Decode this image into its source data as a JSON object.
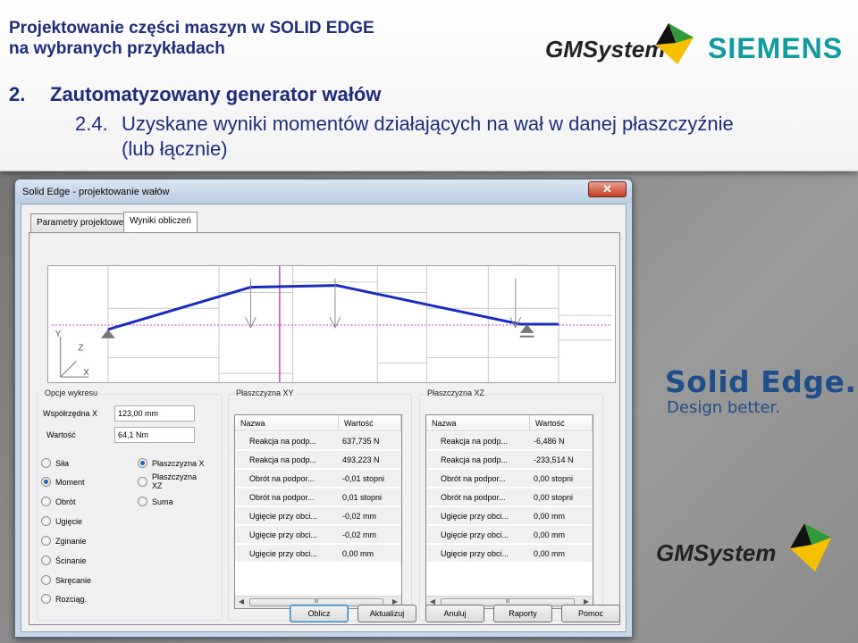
{
  "slide": {
    "title": "Projektowanie części maszyn w SOLID EDGE na wybranych przykładach",
    "title_line1": "Projektowanie części maszyn w SOLID EDGE",
    "title_line2": "na wybranych przykładach",
    "section_num": "2.",
    "section_title": "Zautomatyzowany generator wałów",
    "sub_num": "2.4.",
    "sub_title_line1": "Uzyskane wyniki momentów działających na wał w danej płaszczyźnie",
    "sub_title_line2": "(lub łącznie)",
    "gm_logo_text": "GMSystem",
    "siemens_logo_text": "SIEMENS",
    "solid_edge_logo": "Solid Edge.",
    "solid_edge_tagline": "Design better.",
    "gm_logo2_text": "GMSystem"
  },
  "window": {
    "title": "Solid Edge - projektowanie wałów",
    "close_label": "✕",
    "tabs": [
      {
        "label": "Parametry projektowe",
        "active": false
      },
      {
        "label": "Wyniki obliczeń",
        "active": true
      }
    ],
    "diagram": {
      "axis_y": "Y",
      "axis_z": "Z",
      "axis_x": "X",
      "line_color": "#1a2bbf",
      "marker_color": "#c040c0"
    },
    "options": {
      "group_title": "Opcje wykresu",
      "coord_label": "Współrzędna X",
      "coord_value": "123,00 mm",
      "value_label": "Wartość",
      "value_value": "64,1 Nm",
      "quantity_radios": [
        {
          "label": "Siła",
          "checked": false
        },
        {
          "label": "Moment",
          "checked": true
        },
        {
          "label": "Obrót",
          "checked": false
        },
        {
          "label": "Ugięcie",
          "checked": false
        },
        {
          "label": "Zginanie",
          "checked": false
        },
        {
          "label": "Ścinanie",
          "checked": false
        },
        {
          "label": "Skręcanie",
          "checked": false
        },
        {
          "label": "Rozciąg.",
          "checked": false
        }
      ],
      "plane_radios": [
        {
          "label": "Płaszczyzna X",
          "checked": true
        },
        {
          "label": "Płaszczyzna XZ",
          "checked": false
        },
        {
          "label": "Suma",
          "checked": false
        }
      ]
    },
    "plane_xy": {
      "group_title": "Płaszczyzna XY",
      "col_name": "Nazwa",
      "col_value": "Wartość",
      "rows": [
        {
          "name": "Reakcja na podp...",
          "value": "637,735 N"
        },
        {
          "name": "Reakcja na podp...",
          "value": "493,223 N"
        },
        {
          "name": "Obrót na podpor...",
          "value": "-0,01 stopni"
        },
        {
          "name": "Obrót na podpor...",
          "value": "0,01 stopni"
        },
        {
          "name": "Ugięcie przy obci...",
          "value": "-0,02 mm"
        },
        {
          "name": "Ugięcie przy obci...",
          "value": "-0,02 mm"
        },
        {
          "name": "Ugięcie przy obci...",
          "value": "0,00 mm"
        }
      ]
    },
    "plane_xz": {
      "group_title": "Płaszczyzna XZ",
      "col_name": "Nazwa",
      "col_value": "Wartość",
      "rows": [
        {
          "name": "Reakcja na podp...",
          "value": "-6,486 N"
        },
        {
          "name": "Reakcja na podp...",
          "value": "-233,514 N"
        },
        {
          "name": "Obrót na podpor...",
          "value": "0,00 stopni"
        },
        {
          "name": "Obrót na podpor...",
          "value": "0,00 stopni"
        },
        {
          "name": "Ugięcie przy obci...",
          "value": "0,00 mm"
        },
        {
          "name": "Ugięcie przy obci...",
          "value": "0,00 mm"
        },
        {
          "name": "Ugięcie przy obci...",
          "value": "0,00 mm"
        }
      ]
    },
    "scroll_thumb": "III",
    "buttons": {
      "oblicz": "Oblicz",
      "aktualizuj": "Aktualizuj",
      "anuluj": "Anuluj",
      "raporty": "Raporty",
      "pomoc": "Pomoc"
    }
  }
}
